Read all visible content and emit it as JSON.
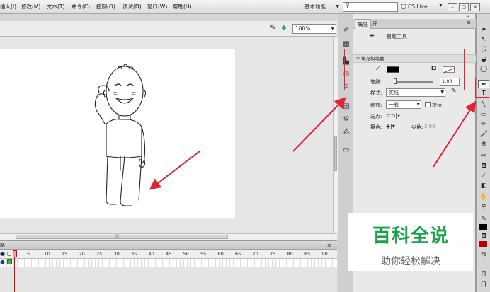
{
  "menu": {
    "items": [
      "插入(I)",
      "修改(M)",
      "文本(T)",
      "命令(C)",
      "控制(O)",
      "调试(D)",
      "窗口(W)",
      "帮助(H)"
    ],
    "workspace": "基本功能",
    "search_value": "",
    "cs_live": "CS Live",
    "min_glyph": "–",
    "max_glyph": "▢",
    "close_glyph": "✕"
  },
  "doc": {
    "zoom": "100%"
  },
  "timeline": {
    "label": "路",
    "frames": [
      "5",
      "10",
      "15",
      "20",
      "25",
      "30",
      "35",
      "40",
      "45",
      "50",
      "55",
      "60",
      "65",
      "70",
      "75",
      "80",
      "85",
      "90"
    ],
    "current_frame": "1"
  },
  "props": {
    "tabs": [
      "属性",
      "库"
    ],
    "tool_name": "钢笔工具",
    "section_title": "填充和笔触",
    "stroke_label": "笔触:",
    "stroke_value": "1.00",
    "style_label": "样式:",
    "style_value": "实线",
    "scale_label": "缩放:",
    "scale_value": "一般",
    "hint_label": "提示",
    "cap_label": "端点:",
    "join_label": "接合:",
    "miter_label": "尖角:",
    "miter_value": "3.00"
  },
  "watermark": {
    "title": "百科全说",
    "subtitle": "助你轻松解决"
  },
  "colors": {
    "annotation_red": "#e22233",
    "watermark_green": "#1aa24a"
  }
}
